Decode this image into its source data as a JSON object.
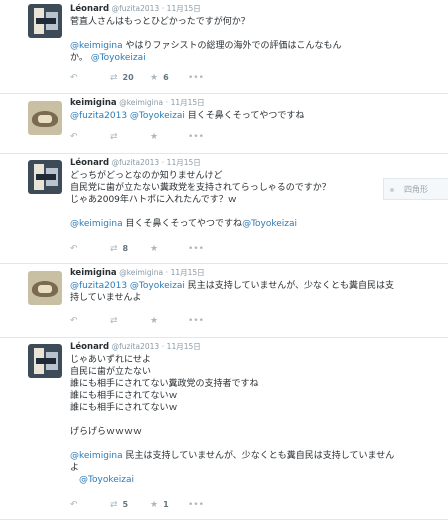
{
  "tweets": [
    {
      "name": "Léonard",
      "handle": "@fuzita2013",
      "sep": "·",
      "time": "11月15日",
      "lines": [
        {
          "parts": [
            {
              "t": "菅直人さんはもっとひどかったですが何か？"
            }
          ]
        },
        {
          "parts": []
        },
        {
          "parts": [
            {
              "t": "@keimigina",
              "m": true
            },
            {
              "t": " やはりファシストの総理の海外での評価はこんなもん"
            }
          ]
        },
        {
          "parts": [
            {
              "t": "か。 "
            },
            {
              "t": "@Toyokeizai",
              "m": true
            }
          ]
        }
      ],
      "actions": {
        "reply_icon": "↶",
        "retweet_icon": "⇄",
        "retweets": "20",
        "fav_icon": "★",
        "favs": "6",
        "more_icon": "•••"
      }
    },
    {
      "name": "keimigina",
      "handle": "@keimigina",
      "sep": "·",
      "time": "11月15日",
      "lines": [
        {
          "parts": [
            {
              "t": "@fuzita2013",
              "m": true
            },
            {
              "t": " "
            },
            {
              "t": "@Toyokeizai",
              "m": true
            },
            {
              "t": " 目くそ鼻くそってやつですね"
            }
          ]
        }
      ],
      "actions": {
        "reply_icon": "↶",
        "retweet_icon": "⇄",
        "retweets": "",
        "fav_icon": "★",
        "favs": "",
        "more_icon": "•••"
      }
    },
    {
      "name": "Léonard",
      "handle": "@fuzita2013",
      "sep": "·",
      "time": "11月15日",
      "lines": [
        {
          "parts": [
            {
              "t": "どっちがどっとなのか知りませんけど"
            }
          ]
        },
        {
          "parts": [
            {
              "t": "自民党に歯が立たない糞政党を支持されてらっしゃるのですか？"
            }
          ]
        },
        {
          "parts": [
            {
              "t": "じゃあ2009年ハトポに入れたんです？ｗ"
            }
          ]
        },
        {
          "parts": []
        },
        {
          "parts": [
            {
              "t": "@keimigina",
              "m": true
            },
            {
              "t": " 目くそ鼻くそってやつですね"
            },
            {
              "t": "@Toyokeizai",
              "m": true
            }
          ]
        }
      ],
      "actions": {
        "reply_icon": "↶",
        "retweet_icon": "⇄",
        "retweets": "8",
        "fav_icon": "★",
        "favs": "",
        "more_icon": "•••"
      }
    },
    {
      "name": "keimigina",
      "handle": "@keimigina",
      "sep": "·",
      "time": "11月15日",
      "lines": [
        {
          "parts": [
            {
              "t": "@fuzita2013",
              "m": true
            },
            {
              "t": " "
            },
            {
              "t": "@Toyokeizai",
              "m": true
            },
            {
              "t": " 民主は支持していませんが、少なくとも糞自民は支"
            }
          ]
        },
        {
          "parts": [
            {
              "t": "持していませんよ"
            }
          ]
        }
      ],
      "actions": {
        "reply_icon": "↶",
        "retweet_icon": "⇄",
        "retweets": "",
        "fav_icon": "★",
        "favs": "",
        "more_icon": "•••"
      }
    },
    {
      "name": "Léonard",
      "handle": "@fuzita2013",
      "sep": "·",
      "time": "11月15日",
      "lines": [
        {
          "parts": [
            {
              "t": "じゃあいずれにせよ"
            }
          ]
        },
        {
          "parts": [
            {
              "t": "自民に歯が立たない"
            }
          ]
        },
        {
          "parts": [
            {
              "t": "誰にも相手にされてない糞政党の支持者ですね"
            }
          ]
        },
        {
          "parts": [
            {
              "t": "誰にも相手にされてないｗ"
            }
          ]
        },
        {
          "parts": [
            {
              "t": "誰にも相手にされてないｗ"
            }
          ]
        },
        {
          "parts": []
        },
        {
          "parts": [
            {
              "t": "げらげらｗｗｗｗ"
            }
          ]
        },
        {
          "parts": []
        },
        {
          "parts": [
            {
              "t": "@keimigina",
              "m": true
            },
            {
              "t": " 民主は支持していませんが、少なくとも糞自民は支持していません"
            }
          ]
        },
        {
          "parts": [
            {
              "t": "よ"
            }
          ]
        },
        {
          "parts": [
            {
              "t": "　"
            },
            {
              "t": "@Toyokeizai",
              "m": true
            }
          ]
        }
      ],
      "actions": {
        "reply_icon": "↶",
        "retweet_icon": "⇄",
        "retweets": "5",
        "fav_icon": "★",
        "favs": "1",
        "more_icon": "•••"
      }
    }
  ],
  "side_widget": {
    "text": "四角形"
  }
}
